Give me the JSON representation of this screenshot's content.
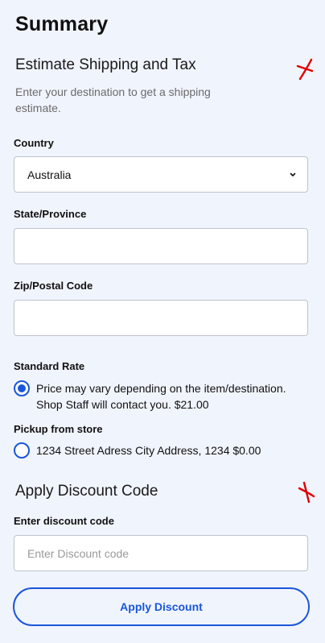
{
  "summary": {
    "title": "Summary"
  },
  "shipping": {
    "heading": "Estimate Shipping and Tax",
    "description": "Enter your destination to get a shipping estimate.",
    "country": {
      "label": "Country",
      "value": "Australia"
    },
    "state": {
      "label": "State/Province",
      "value": ""
    },
    "zip": {
      "label": "Zip/Postal Code",
      "value": ""
    },
    "standard_rate": {
      "label": "Standard Rate",
      "option_text": "Price may vary depending on the item/destination. Shop Staff will contact you. $21.00",
      "selected": true
    },
    "pickup": {
      "label": "Pickup from store",
      "option_text": "1234 Street Adress City Address, 1234 $0.00",
      "selected": false
    }
  },
  "discount": {
    "heading": "Apply Discount Code",
    "input_label": "Enter discount code",
    "placeholder": "Enter Discount code",
    "button_label": "Apply Discount"
  },
  "colors": {
    "background": "#f0f4fc",
    "accent": "#1a56db",
    "annotation_mark": "#e00000"
  },
  "icons": {
    "annotation": "red-x-mark-icon",
    "select": "chevron-down-icon",
    "radio_selected": "radio-checked-icon",
    "radio_unselected": "radio-unchecked-icon"
  }
}
